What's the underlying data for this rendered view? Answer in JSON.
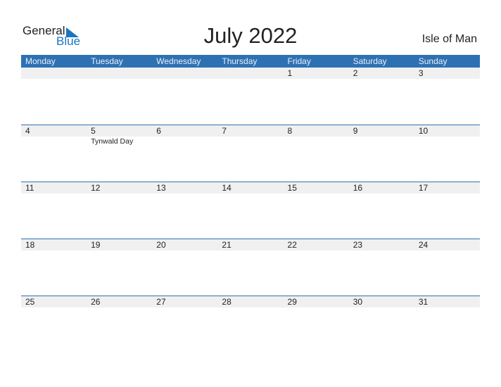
{
  "logo": {
    "line1": "General",
    "line2": "Blue"
  },
  "title": "July 2022",
  "country": "Isle of Man",
  "weekdays": [
    "Monday",
    "Tuesday",
    "Wednesday",
    "Thursday",
    "Friday",
    "Saturday",
    "Sunday"
  ],
  "weeks": [
    [
      {
        "d": ""
      },
      {
        "d": ""
      },
      {
        "d": ""
      },
      {
        "d": ""
      },
      {
        "d": "1"
      },
      {
        "d": "2"
      },
      {
        "d": "3"
      }
    ],
    [
      {
        "d": "4"
      },
      {
        "d": "5",
        "event": "Tynwald Day"
      },
      {
        "d": "6"
      },
      {
        "d": "7"
      },
      {
        "d": "8"
      },
      {
        "d": "9"
      },
      {
        "d": "10"
      }
    ],
    [
      {
        "d": "11"
      },
      {
        "d": "12"
      },
      {
        "d": "13"
      },
      {
        "d": "14"
      },
      {
        "d": "15"
      },
      {
        "d": "16"
      },
      {
        "d": "17"
      }
    ],
    [
      {
        "d": "18"
      },
      {
        "d": "19"
      },
      {
        "d": "20"
      },
      {
        "d": "21"
      },
      {
        "d": "22"
      },
      {
        "d": "23"
      },
      {
        "d": "24"
      }
    ],
    [
      {
        "d": "25"
      },
      {
        "d": "26"
      },
      {
        "d": "27"
      },
      {
        "d": "28"
      },
      {
        "d": "29"
      },
      {
        "d": "30"
      },
      {
        "d": "31"
      }
    ]
  ],
  "colors": {
    "accent": "#2e71b3",
    "logo_blue": "#1a75c2",
    "date_band": "#f0f0f0"
  }
}
